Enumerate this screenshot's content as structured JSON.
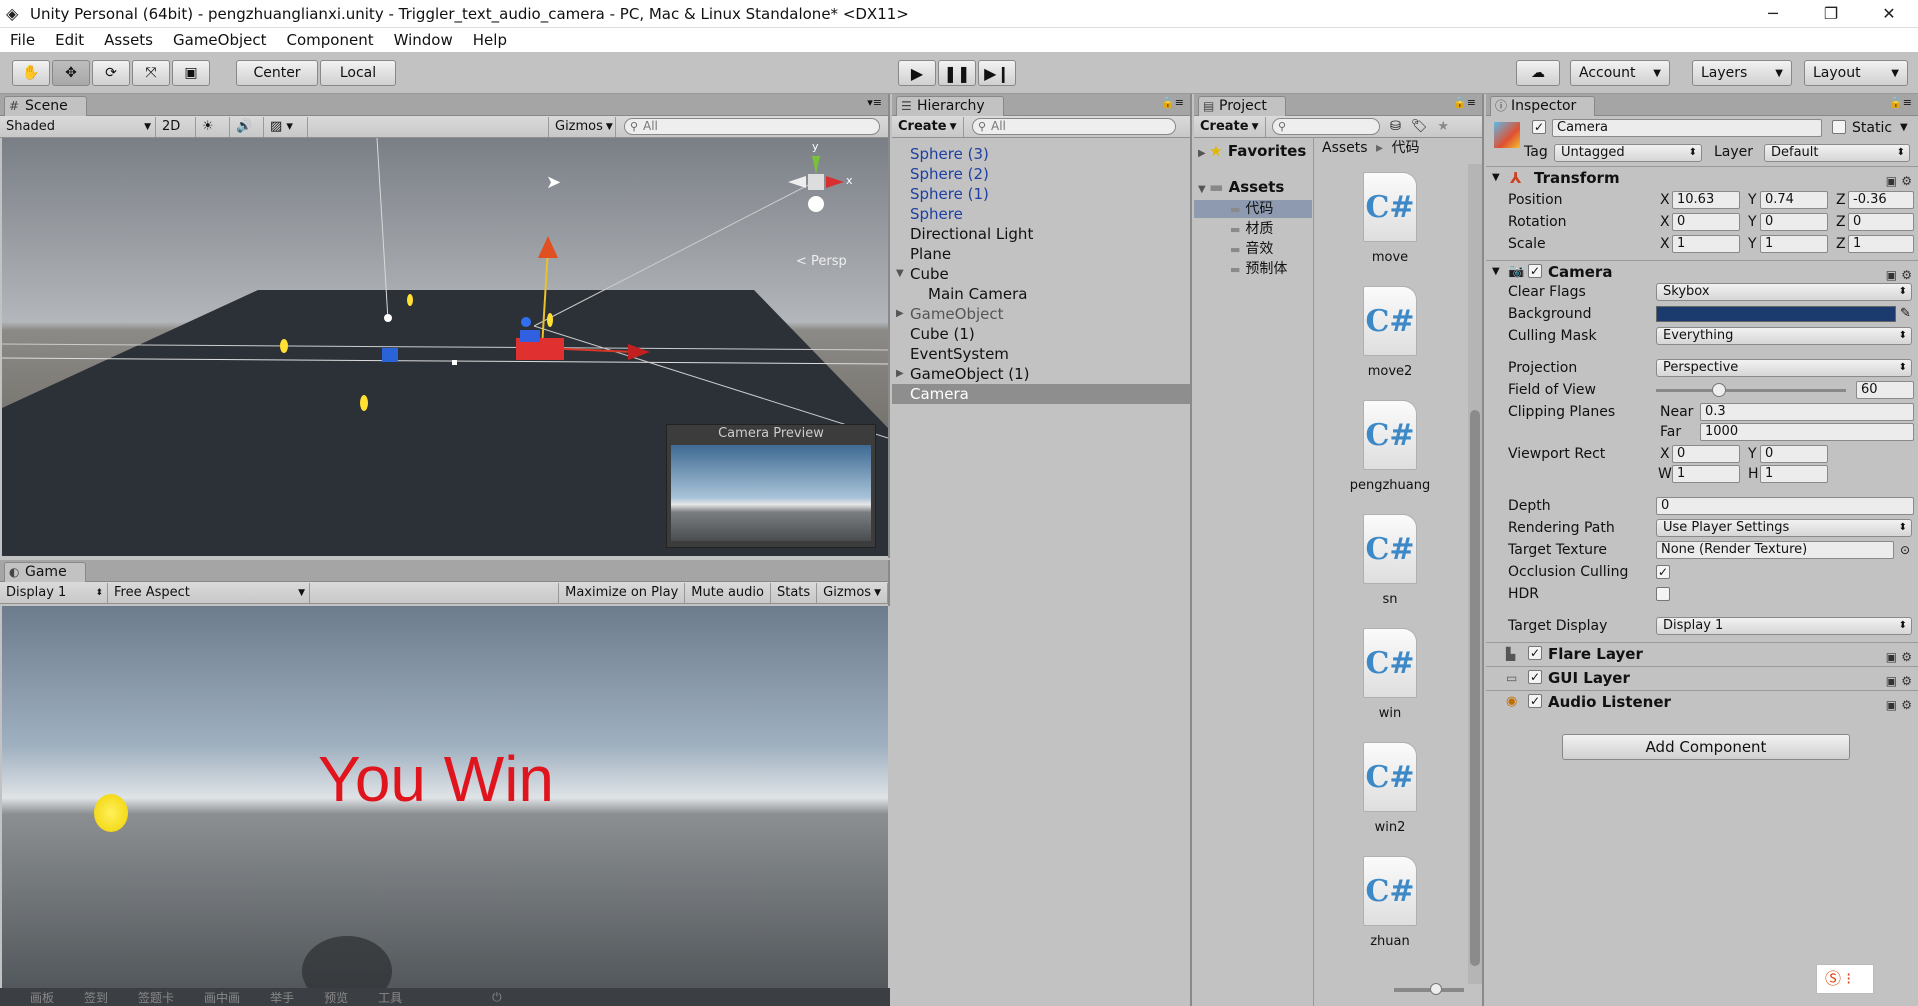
{
  "window": {
    "title": "Unity Personal (64bit) - pengzhuanglianxi.unity - Triggler_text_audio_camera - PC, Mac & Linux Standalone* <DX11>",
    "minimize": "─",
    "maximize": "❐",
    "close": "✕"
  },
  "menu": [
    "File",
    "Edit",
    "Assets",
    "GameObject",
    "Component",
    "Window",
    "Help"
  ],
  "toolbar": {
    "center": "Center",
    "local": "Local",
    "account": "Account",
    "layers": "Layers",
    "layout": "Layout"
  },
  "scene": {
    "tab": "Scene",
    "shading": "Shaded",
    "mode2d": "2D",
    "gizmos": "Gizmos",
    "search_placeholder": "All",
    "persp": "Persp",
    "camera_preview": "Camera Preview",
    "axis_y": "y",
    "axis_x": "x"
  },
  "game": {
    "tab": "Game",
    "display": "Display 1",
    "aspect": "Free Aspect",
    "maximize": "Maximize on Play",
    "mute": "Mute audio",
    "stats": "Stats",
    "gizmos": "Gizmos",
    "win_text": "You Win"
  },
  "hierarchy": {
    "tab": "Hierarchy",
    "create": "Create",
    "search_placeholder": "All",
    "items": [
      {
        "label": "Sphere (3)",
        "type": "prefab",
        "indent": 0,
        "arrow": ""
      },
      {
        "label": "Sphere (2)",
        "type": "prefab",
        "indent": 0,
        "arrow": ""
      },
      {
        "label": "Sphere (1)",
        "type": "prefab",
        "indent": 0,
        "arrow": ""
      },
      {
        "label": "Sphere",
        "type": "prefab",
        "indent": 0,
        "arrow": ""
      },
      {
        "label": "Directional Light",
        "type": "normal",
        "indent": 0,
        "arrow": ""
      },
      {
        "label": "Plane",
        "type": "normal",
        "indent": 0,
        "arrow": ""
      },
      {
        "label": "Cube",
        "type": "normal",
        "indent": 0,
        "arrow": "▼"
      },
      {
        "label": "Main Camera",
        "type": "normal",
        "indent": 1,
        "arrow": ""
      },
      {
        "label": "GameObject",
        "type": "inactive",
        "indent": 0,
        "arrow": "▶"
      },
      {
        "label": "Cube (1)",
        "type": "normal",
        "indent": 0,
        "arrow": ""
      },
      {
        "label": "EventSystem",
        "type": "normal",
        "indent": 0,
        "arrow": ""
      },
      {
        "label": "GameObject (1)",
        "type": "normal",
        "indent": 0,
        "arrow": "▶"
      },
      {
        "label": "Camera",
        "type": "selected",
        "indent": 0,
        "arrow": ""
      }
    ]
  },
  "project": {
    "tab": "Project",
    "create": "Create",
    "favorites": "Favorites",
    "assets": "Assets",
    "breadcrumb_root": "Assets",
    "breadcrumb_sep": "▸",
    "breadcrumb_current": "代码",
    "folders": [
      "代码",
      "材质",
      "音效",
      "预制体"
    ],
    "scripts": [
      "move",
      "move2",
      "pengzhuang",
      "sn",
      "win",
      "win2",
      "zhuan"
    ],
    "script_glyph": "C#"
  },
  "inspector": {
    "tab": "Inspector",
    "object_name": "Camera",
    "static_label": "Static",
    "tag_label": "Tag",
    "tag_value": "Untagged",
    "layer_label": "Layer",
    "layer_value": "Default",
    "transform": {
      "title": "Transform",
      "position_label": "Position",
      "rotation_label": "Rotation",
      "scale_label": "Scale",
      "position": [
        "10.63",
        "0.74",
        "-0.36"
      ],
      "rotation": [
        "0",
        "0",
        "0"
      ],
      "scale": [
        "1",
        "1",
        "1"
      ]
    },
    "camera": {
      "title": "Camera",
      "clear_flags_label": "Clear Flags",
      "clear_flags": "Skybox",
      "background_label": "Background",
      "background_color": "#1b3a6e",
      "culling_label": "Culling Mask",
      "culling": "Everything",
      "projection_label": "Projection",
      "projection": "Perspective",
      "fov_label": "Field of View",
      "fov": "60",
      "fov_fraction": 0.33,
      "clipping_label": "Clipping Planes",
      "near_label": "Near",
      "near": "0.3",
      "far_label": "Far",
      "far": "1000",
      "viewport_label": "Viewport Rect",
      "vx": "0",
      "vy": "0",
      "vw": "1",
      "vh": "1",
      "depth_label": "Depth",
      "depth": "0",
      "rendering_label": "Rendering Path",
      "rendering": "Use Player Settings",
      "target_texture_label": "Target Texture",
      "target_texture": "None (Render Texture)",
      "occlusion_label": "Occlusion Culling",
      "hdr_label": "HDR",
      "target_display_label": "Target Display",
      "target_display": "Display 1"
    },
    "components": [
      "Flare Layer",
      "GUI Layer",
      "Audio Listener"
    ],
    "add_component": "Add Component"
  },
  "axis_letters": {
    "x": "X",
    "y": "Y",
    "z": "Z",
    "w": "W",
    "h": "H"
  },
  "taskbar": [
    "画板",
    "签到",
    "签题卡",
    "画中画",
    "举手",
    "预览",
    "工具"
  ]
}
